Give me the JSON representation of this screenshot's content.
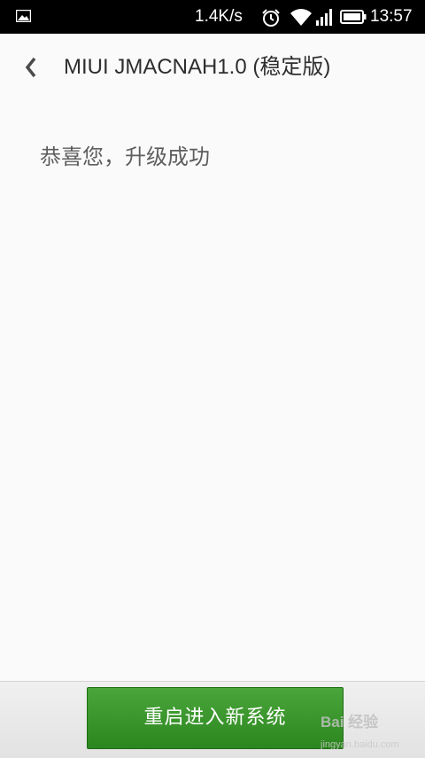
{
  "status_bar": {
    "net_speed": "1.4K/s",
    "time": "13:57",
    "icons": [
      "image-notification-icon",
      "alarm-icon",
      "wifi-icon",
      "signal-icon",
      "battery-icon"
    ]
  },
  "header": {
    "title": "MIUI JMACNAH1.0 (稳定版)",
    "back_icon": "chevron-left-icon"
  },
  "main": {
    "message": "恭喜您，升级成功"
  },
  "footer": {
    "reboot_label": "重启进入新系统"
  },
  "watermark": {
    "main": "Bai 经验",
    "sub": "jingyan.baidu.com"
  },
  "colors": {
    "accent": "#3a9a2e",
    "background": "#fafafa",
    "status_bar": "#000000"
  }
}
